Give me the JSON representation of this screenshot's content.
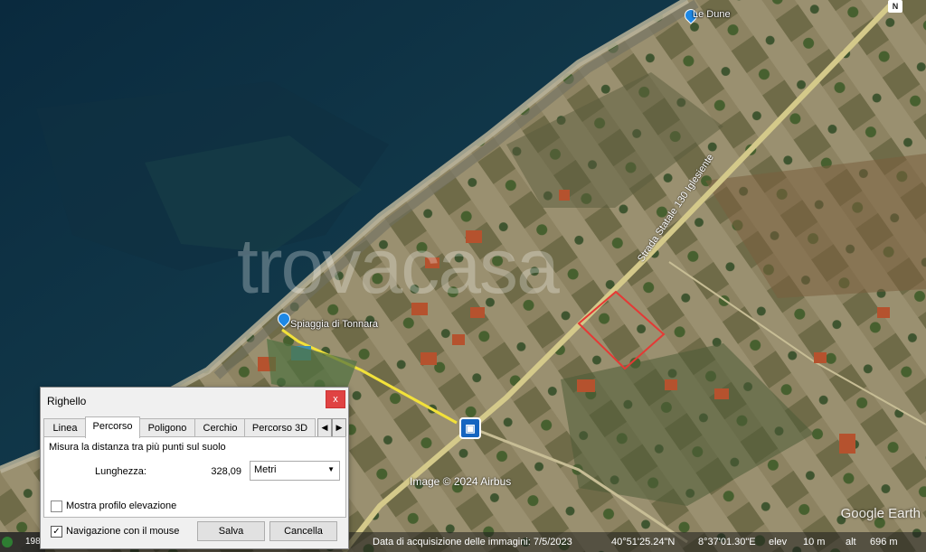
{
  "map": {
    "watermark": "trovacasa",
    "place_labels": [
      {
        "id": "le-dune",
        "text": "Le Dune"
      },
      {
        "id": "spiaggia",
        "text": "Spiaggia di Tonnara"
      }
    ],
    "road_label": "Strada Statale 130 Iglesiente",
    "north": "N",
    "image_credit": "Image © 2024 Airbus",
    "brand": "Google Earth",
    "bus_icon": "bus-stop-icon",
    "measure_color": "#e53935",
    "route_color": "#f2e13a"
  },
  "dialog": {
    "title": "Righello",
    "close": "x",
    "tabs": [
      "Linea",
      "Percorso",
      "Poligono",
      "Cerchio",
      "Percorso 3D"
    ],
    "active_tab": "Percorso",
    "description": "Misura la distanza tra più punti sul suolo",
    "length_label": "Lunghezza:",
    "length_value": "328,09",
    "unit": "Metri",
    "elevation_profile_label": "Mostra profilo elevazione",
    "elevation_profile_checked": false,
    "mouse_nav_label": "Navigazione con il mouse",
    "mouse_nav_checked": true,
    "save_label": "Salva",
    "cancel_label": "Cancella"
  },
  "status_bar": {
    "corner": "198",
    "acquisition_date": "Data di acquisizione delle immagini: 7/5/2023",
    "latitude": "40°51'25.24\"N",
    "longitude": "8°37'01.30\"E",
    "elev_label": "elev",
    "elev_value": "10 m",
    "alt_label": "alt",
    "alt_value": "696 m"
  }
}
